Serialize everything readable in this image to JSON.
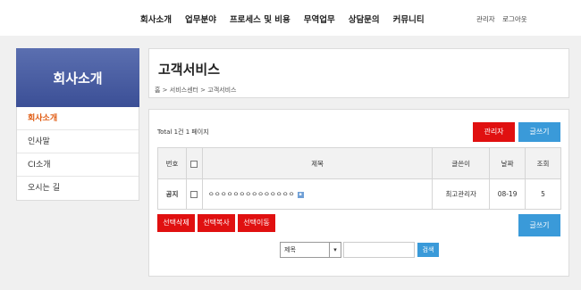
{
  "topnav": {
    "menu": [
      "회사소개",
      "업무분야",
      "프로세스 및 비용",
      "무역업무",
      "상담문의",
      "커뮤니티"
    ],
    "admin": "관리자",
    "logout": "로그아웃"
  },
  "sidebar": {
    "title": "회사소개",
    "items": [
      {
        "label": "회사소개"
      },
      {
        "label": "인사말"
      },
      {
        "label": "CI소개"
      },
      {
        "label": "오시는 길"
      }
    ]
  },
  "header": {
    "title": "고객서비스",
    "breadcrumb": "홈 > 서비스센터 > 고객서비스"
  },
  "board": {
    "total": "Total 1건 1 페이지",
    "admin_button": "관리자",
    "write_button": "글쓰기",
    "columns": {
      "no": "번호",
      "subject": "제목",
      "author": "글쓴이",
      "date": "날짜",
      "views": "조회"
    },
    "rows": [
      {
        "no": "공지",
        "subject": "ㅇㅇㅇㅇㅇㅇㅇㅇㅇㅇㅇㅇㅇㅇ",
        "author": "최고관리자",
        "date": "08-19",
        "views": "5"
      }
    ],
    "actions": {
      "delete": "선택삭제",
      "copy": "선택복사",
      "move": "선택이동",
      "write": "글쓰기"
    }
  },
  "search": {
    "field_selected": "제목",
    "input_value": "",
    "button": "검색"
  },
  "colors": {
    "accent_blue": "#3a9ad9",
    "accent_red": "#e01010",
    "sidebar_active": "#e05a10",
    "sidebar_header": "#3b4f96"
  }
}
